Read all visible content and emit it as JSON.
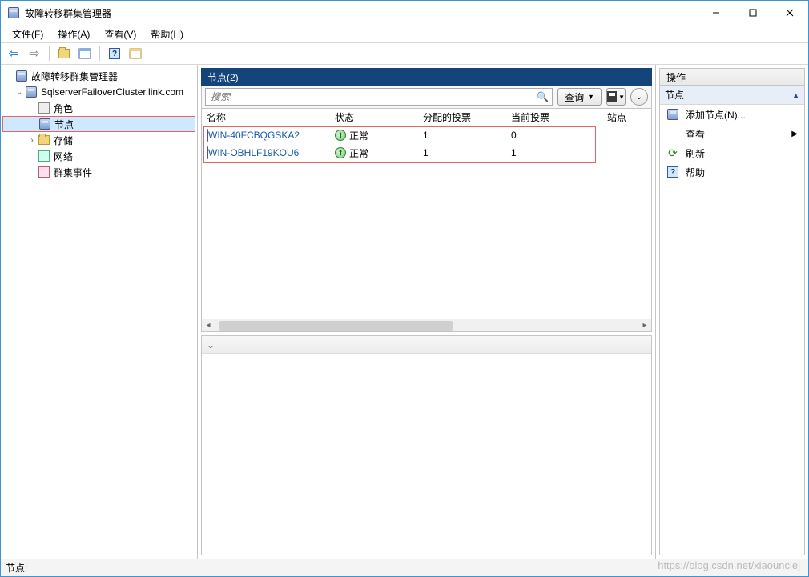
{
  "window": {
    "title": "故障转移群集管理器"
  },
  "menu": {
    "file": "文件(F)",
    "action": "操作(A)",
    "view": "查看(V)",
    "help": "帮助(H)"
  },
  "tree": {
    "root": "故障转移群集管理器",
    "cluster": "SqlserverFailoverCluster.link.com",
    "roles": "角色",
    "nodes": "节点",
    "storage": "存储",
    "network": "网络",
    "events": "群集事件"
  },
  "center": {
    "title": "节点(2)",
    "search_placeholder": "搜索",
    "query_btn": "查询",
    "columns": {
      "name": "名称",
      "status": "状态",
      "assigned_votes": "分配的投票",
      "current_votes": "当前投票",
      "site": "站点"
    },
    "rows": [
      {
        "name": "WIN-40FCBQGSKA2",
        "status": "正常",
        "assigned": "1",
        "current": "0",
        "site": ""
      },
      {
        "name": "WIN-OBHLF19KOU6",
        "status": "正常",
        "assigned": "1",
        "current": "1",
        "site": ""
      }
    ]
  },
  "actions": {
    "header": "操作",
    "section": "节点",
    "add_node": "添加节点(N)...",
    "view": "查看",
    "refresh": "刷新",
    "help": "帮助"
  },
  "statusbar": {
    "label": "节点:"
  },
  "watermark": "https://blog.csdn.net/xiaounclej"
}
